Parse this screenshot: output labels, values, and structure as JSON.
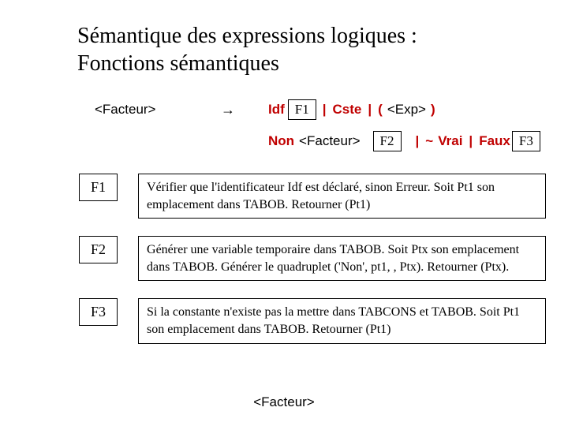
{
  "title_line1": "Sémantique des expressions logiques :",
  "title_line2": "Fonctions sémantiques",
  "grammar": {
    "lhs": "<Facteur>",
    "arrow": "→",
    "alt1": {
      "idf": "Idf",
      "tag": "F1",
      "cste": "Cste",
      "grp_open": "(",
      "grp_exp": "<Exp>",
      "grp_close": ")"
    },
    "alt2": {
      "non": "Non",
      "fact": "<Facteur>",
      "tag": "F2",
      "tilde": "~",
      "vrai": "Vrai",
      "faux": "Faux",
      "tag2": "F3"
    },
    "bar": "|"
  },
  "rules": [
    {
      "tag": "F1",
      "text": "Vérifier que l'identificateur Idf est déclaré, sinon Erreur. Soit Pt1 son emplacement dans TABOB. Retourner (Pt1)"
    },
    {
      "tag": "F2",
      "text": "Générer une variable temporaire dans TABOB. Soit Ptx son emplacement dans TABOB. Générer le quadruplet ('Non', pt1, , Ptx). Retourner (Ptx)."
    },
    {
      "tag": "F3",
      "text": "Si la constante n'existe pas la mettre dans TABCONS et TABOB. Soit Pt1 son emplacement dans TABOB. Retourner (Pt1)"
    }
  ],
  "footer": "<Facteur>"
}
